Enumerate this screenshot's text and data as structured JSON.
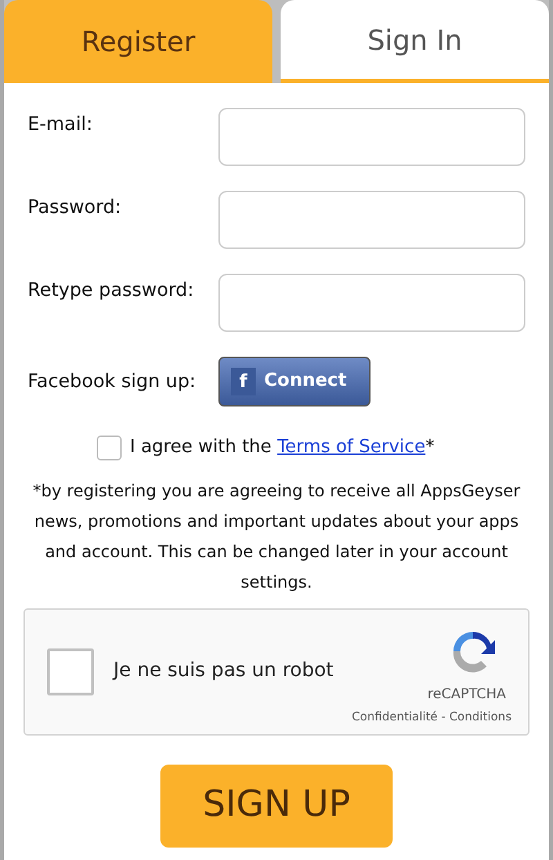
{
  "tabs": [
    {
      "label": "Register",
      "selected": true
    },
    {
      "label": "Sign In",
      "selected": false
    }
  ],
  "fields": [
    {
      "label": "E-mail:"
    },
    {
      "label": "Password:"
    },
    {
      "label": "Retype password:"
    }
  ],
  "facebook": {
    "label": "Facebook sign up:",
    "button": "Connect",
    "icon": "f"
  },
  "agree": {
    "checked": false,
    "prefix": "I agree with the",
    "link": "Terms of Service",
    "suffix": "*"
  },
  "notice": "*by registering you are agreeing to receive all AppsGeyser news, promotions and important updates about your apps and account. This can be changed later in your account settings.",
  "captcha": {
    "checked": false,
    "label": "Je ne suis pas un robot",
    "brand": "reCAPTCHA",
    "links": "Confidentialité - Conditions"
  },
  "submit": "SIGN UP"
}
